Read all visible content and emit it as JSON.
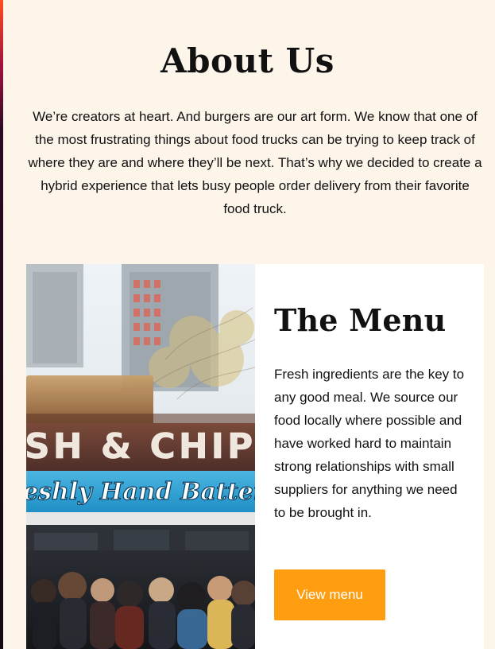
{
  "about": {
    "title": "About Us",
    "text": "We’re creators at heart. And burgers are our art form. We know that one of the most frustrating things about food trucks can be trying to keep track of where they are and where they’ll be next. That’s why we decided to create a hybrid experience that lets busy people order delivery from their favorite food truck."
  },
  "menu": {
    "title": "The Menu",
    "text": "Fresh ingredients are the key to any good meal. We source our food locally where possible and have worked hard to maintain strong relationships with small suppliers for anything we need to be brought in.",
    "button_label": "View menu",
    "photo_signs": {
      "top": "SH & CHIP",
      "bottom": "eshly Hand Batterec"
    }
  },
  "colors": {
    "background": "#fdf5ea",
    "card": "#ffffff",
    "button": "#ff9d10",
    "text": "#111111"
  },
  "icons": {
    "photo": "food-truck-photo"
  }
}
